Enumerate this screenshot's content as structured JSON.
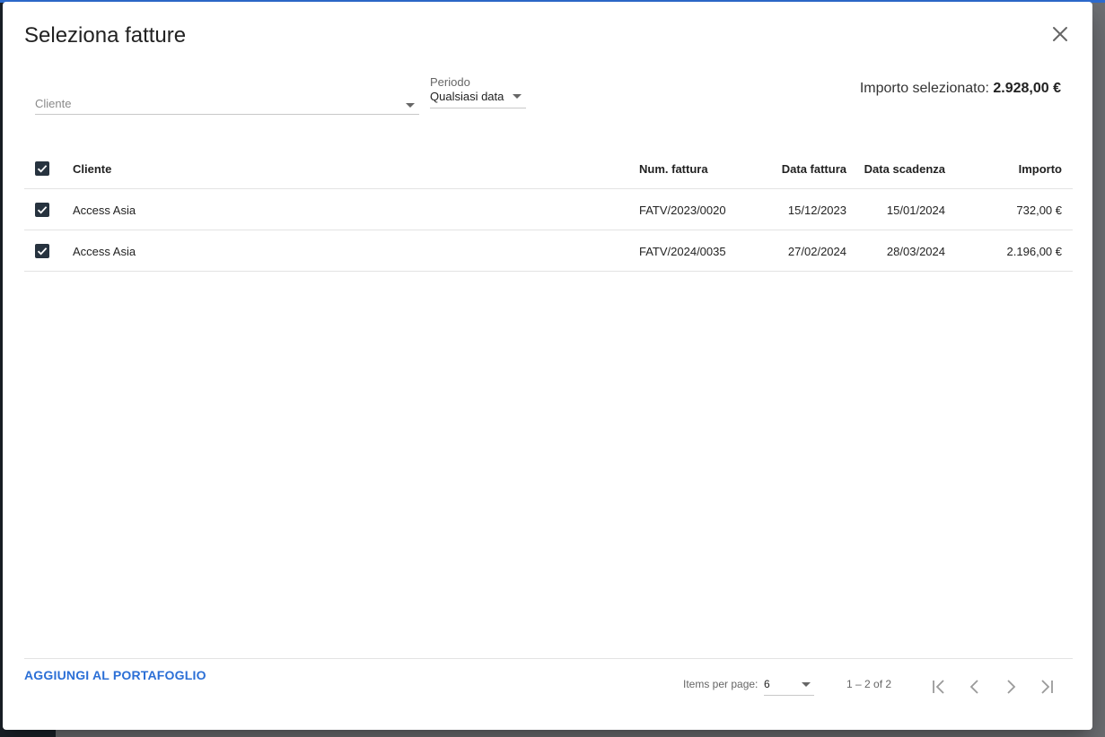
{
  "dialog": {
    "title": "Seleziona fatture",
    "filters": {
      "cliente_placeholder": "Cliente",
      "periodo_label": "Periodo",
      "periodo_value": "Qualsiasi data"
    },
    "importo": {
      "label": "Importo selezionato:",
      "value": "2.928,00 €"
    },
    "table": {
      "columns": [
        "Cliente",
        "Num. fattura",
        "Data fattura",
        "Data scadenza",
        "Importo"
      ],
      "rows": [
        {
          "cliente": "Access Asia",
          "num": "FATV/2023/0020",
          "data": "15/12/2023",
          "scadenza": "15/01/2024",
          "importo": "732,00 €",
          "checked": true
        },
        {
          "cliente": "Access Asia",
          "num": "FATV/2024/0035",
          "data": "27/02/2024",
          "scadenza": "28/03/2024",
          "importo": "2.196,00 €",
          "checked": true
        }
      ],
      "select_all_checked": true
    },
    "footer": {
      "add_label": "AGGIUNGI AL PORTAFOGLIO",
      "items_per_page_label": "Items per page:",
      "items_per_page_value": "6",
      "range_label": "1 – 2 of 2"
    }
  },
  "colors": {
    "accent": "#2b6fd6",
    "checkbox": "#27333f"
  },
  "icons": {
    "close": "close-icon",
    "check": "check-icon",
    "first_page": "first-page-icon",
    "prev_page": "chevron-left-icon",
    "next_page": "chevron-right-icon",
    "last_page": "last-page-icon"
  }
}
